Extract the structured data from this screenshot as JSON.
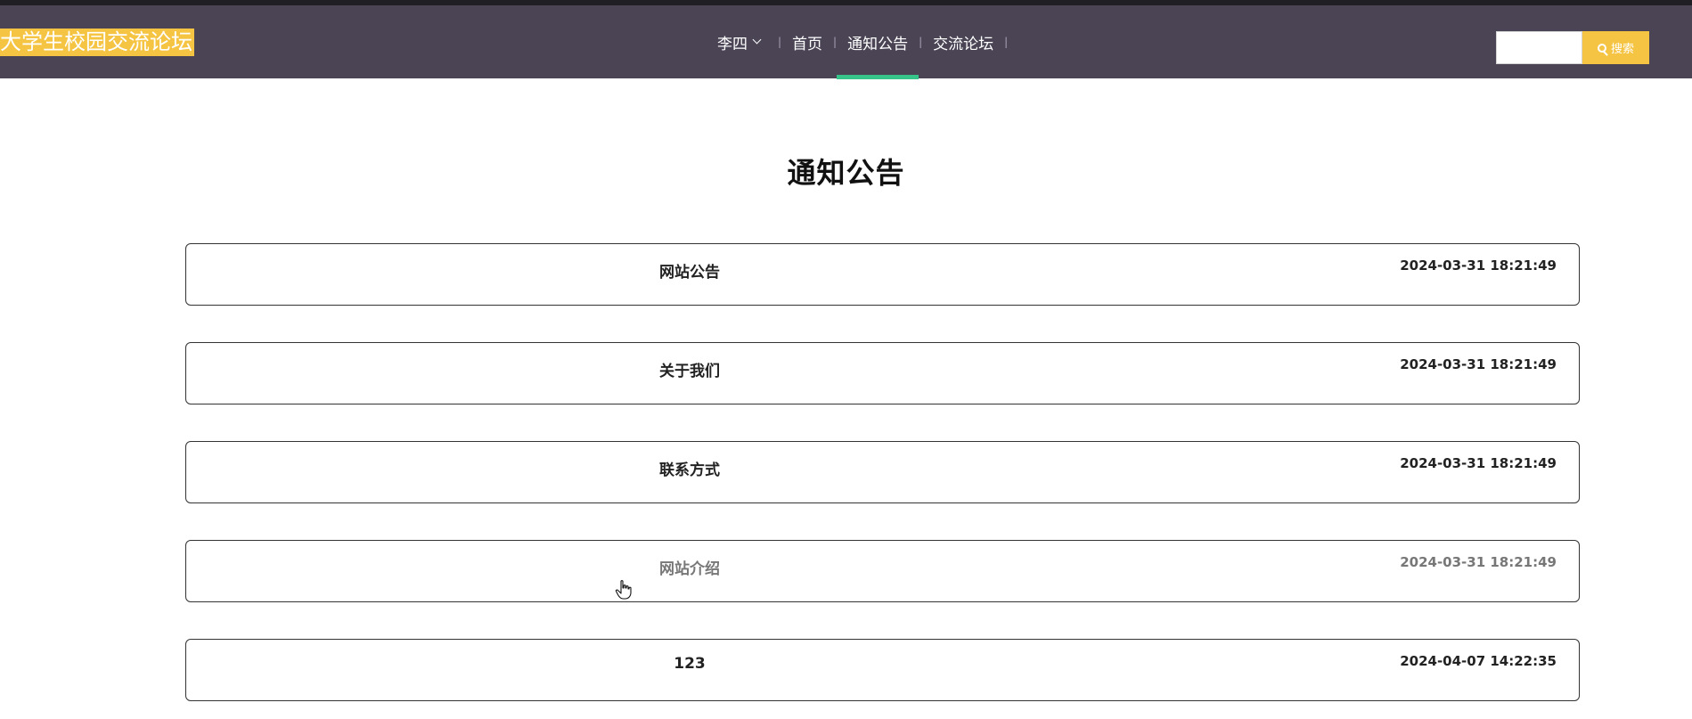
{
  "header": {
    "site_title": "大学生校园交流论坛",
    "user_name": "李四",
    "nav_items": [
      {
        "label": "首页",
        "active": false
      },
      {
        "label": "通知公告",
        "active": true
      },
      {
        "label": "交流论坛",
        "active": false
      }
    ],
    "search": {
      "value": "",
      "button_label": "搜索"
    },
    "colors": {
      "navbar": "#4a4455",
      "accent": "#f5c443",
      "active_tab": "#37c48a"
    }
  },
  "main": {
    "page_title": "通知公告",
    "notices": [
      {
        "title": "网站公告",
        "time": "2024-03-31 18:21:49"
      },
      {
        "title": "关于我们",
        "time": "2024-03-31 18:21:49"
      },
      {
        "title": "联系方式",
        "time": "2024-03-31 18:21:49"
      },
      {
        "title": "网站介绍",
        "time": "2024-03-31 18:21:49"
      },
      {
        "title": "123",
        "time": "2024-04-07 14:22:35"
      }
    ]
  }
}
